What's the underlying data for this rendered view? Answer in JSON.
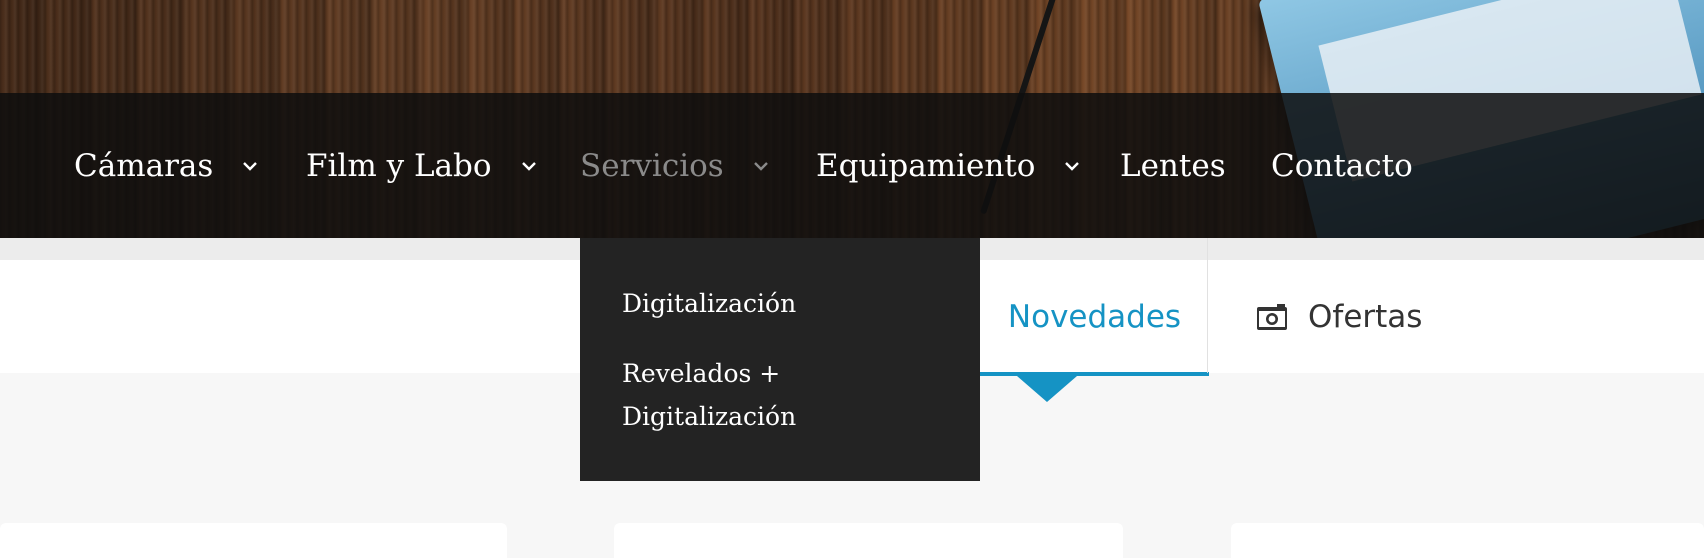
{
  "nav": {
    "items": [
      {
        "label": "Cámaras",
        "has_dropdown": true
      },
      {
        "label": "Film y Labo",
        "has_dropdown": true
      },
      {
        "label": "Servicios",
        "has_dropdown": true,
        "active": true
      },
      {
        "label": "Equipamiento",
        "has_dropdown": true
      },
      {
        "label": "Lentes",
        "has_dropdown": false
      },
      {
        "label": "Contacto",
        "has_dropdown": false
      }
    ],
    "icon": "chevron-down-icon"
  },
  "dropdown": {
    "items": [
      {
        "label": "Digitalización"
      },
      {
        "label": "Revelados + Digitalización"
      }
    ]
  },
  "tabs": {
    "novedades": {
      "label": "Novedades",
      "active": true
    },
    "ofertas": {
      "label": "Ofertas",
      "icon": "camera-icon"
    }
  },
  "colors": {
    "accent": "#1593c4",
    "nav_bg": "#0e0e0e",
    "dropdown_bg": "#232323",
    "active_nav": "#8a8a8a"
  }
}
